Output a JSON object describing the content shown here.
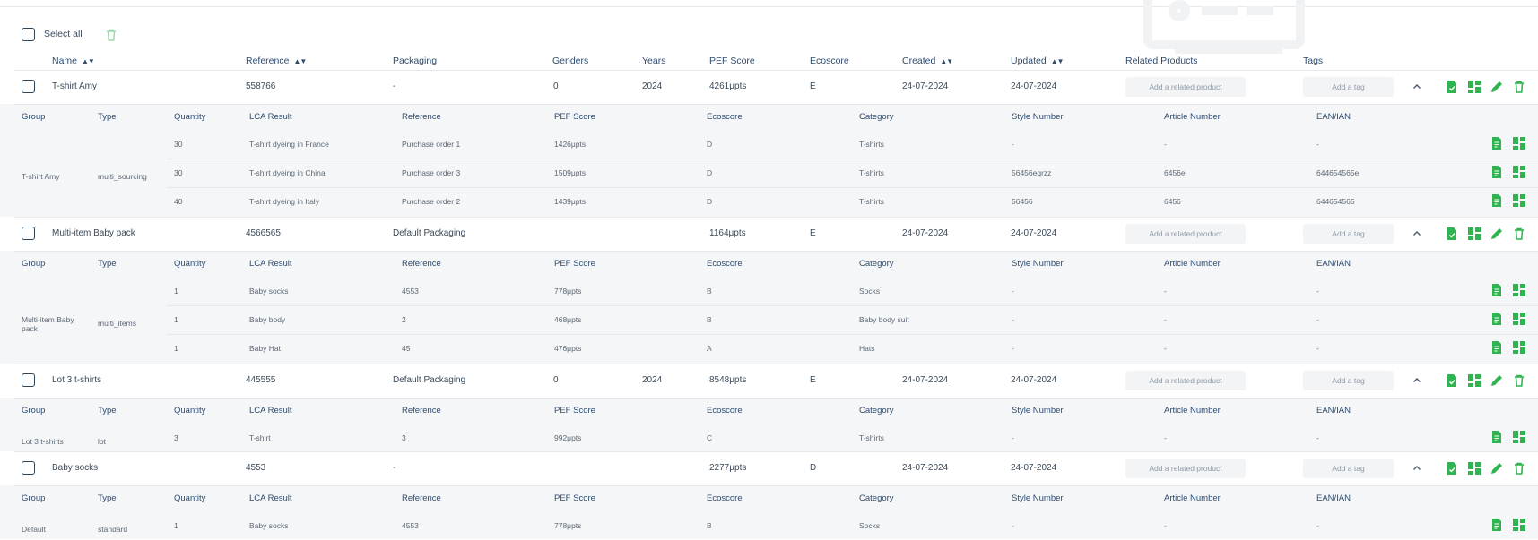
{
  "toolbar": {
    "select_all_label": "Select all",
    "delete_icon": "trash-icon"
  },
  "columns": [
    {
      "label": "Name",
      "sortable": true
    },
    {
      "label": "Reference",
      "sortable": true
    },
    {
      "label": "Packaging",
      "sortable": false
    },
    {
      "label": "Genders",
      "sortable": false
    },
    {
      "label": "Years",
      "sortable": false
    },
    {
      "label": "PEF Score",
      "sortable": false
    },
    {
      "label": "Ecoscore",
      "sortable": false
    },
    {
      "label": "Created",
      "sortable": true
    },
    {
      "label": "Updated",
      "sortable": true
    },
    {
      "label": "Related Products",
      "sortable": false
    },
    {
      "label": "Tags",
      "sortable": false
    }
  ],
  "sub_columns": [
    "Group",
    "Type",
    "Quantity",
    "LCA Result",
    "Reference",
    "PEF Score",
    "Ecoscore",
    "Category",
    "Style Number",
    "Article Number",
    "EAN/IAN"
  ],
  "pill_labels": {
    "related": "Add a related product",
    "tag": "Add a tag"
  },
  "colors": {
    "accent": "#2fb451",
    "header_text": "#2e4c70",
    "sub_bg": "#f4f6f8"
  },
  "products": [
    {
      "name": "T-shirt Amy",
      "reference": "558766",
      "packaging": "-",
      "genders": "0",
      "years": "2024",
      "pef": "4261μpts",
      "ecoscore": "E",
      "created": "24-07-2024",
      "updated": "24-07-2024",
      "group": "T-shirt Amy",
      "type": "multi_sourcing",
      "items": [
        {
          "quantity": "30",
          "lca": "T-shirt dyeing in France",
          "reference": "Purchase order 1",
          "pef": "1426μpts",
          "ecoscore": "D",
          "category": "T-shirts",
          "style": "-",
          "article": "-",
          "ean": "-"
        },
        {
          "quantity": "30",
          "lca": "T-shirt dyeing in China",
          "reference": "Purchase order 3",
          "pef": "1509μpts",
          "ecoscore": "D",
          "category": "T-shirts",
          "style": "56456eqrzz",
          "article": "6456e",
          "ean": "644654565e"
        },
        {
          "quantity": "40",
          "lca": "T-shirt dyeing in Italy",
          "reference": "Purchase order 2",
          "pef": "1439μpts",
          "ecoscore": "D",
          "category": "T-shirts",
          "style": "56456",
          "article": "6456",
          "ean": "644654565"
        }
      ]
    },
    {
      "name": "Multi-item Baby pack",
      "reference": "4566565",
      "packaging": "Default Packaging",
      "genders": "",
      "years": "",
      "pef": "1164μpts",
      "ecoscore": "E",
      "created": "24-07-2024",
      "updated": "24-07-2024",
      "group": "Multi-item Baby pack",
      "type": "multi_items",
      "items": [
        {
          "quantity": "1",
          "lca": "Baby socks",
          "reference": "4553",
          "pef": "778μpts",
          "ecoscore": "B",
          "category": "Socks",
          "style": "-",
          "article": "-",
          "ean": "-"
        },
        {
          "quantity": "1",
          "lca": "Baby body",
          "reference": "2",
          "pef": "468μpts",
          "ecoscore": "B",
          "category": "Baby body suit",
          "style": "-",
          "article": "-",
          "ean": "-"
        },
        {
          "quantity": "1",
          "lca": "Baby Hat",
          "reference": "45",
          "pef": "476μpts",
          "ecoscore": "A",
          "category": "Hats",
          "style": "-",
          "article": "-",
          "ean": "-"
        }
      ]
    },
    {
      "name": "Lot 3 t-shirts",
      "reference": "445555",
      "packaging": "Default Packaging",
      "genders": "0",
      "years": "2024",
      "pef": "8548μpts",
      "ecoscore": "E",
      "created": "24-07-2024",
      "updated": "24-07-2024",
      "group": "Lot 3 t-shirts",
      "type": "lot",
      "items": [
        {
          "quantity": "3",
          "lca": "T-shirt",
          "reference": "3",
          "pef": "992μpts",
          "ecoscore": "C",
          "category": "T-shirts",
          "style": "-",
          "article": "-",
          "ean": "-"
        }
      ]
    },
    {
      "name": "Baby socks",
      "reference": "4553",
      "packaging": "-",
      "genders": "",
      "years": "",
      "pef": "2277μpts",
      "ecoscore": "D",
      "created": "24-07-2024",
      "updated": "24-07-2024",
      "group": "Default",
      "type": "standard",
      "items": [
        {
          "quantity": "1",
          "lca": "Baby socks",
          "reference": "4553",
          "pef": "778μpts",
          "ecoscore": "B",
          "category": "Socks",
          "style": "-",
          "article": "-",
          "ean": "-"
        }
      ]
    }
  ]
}
